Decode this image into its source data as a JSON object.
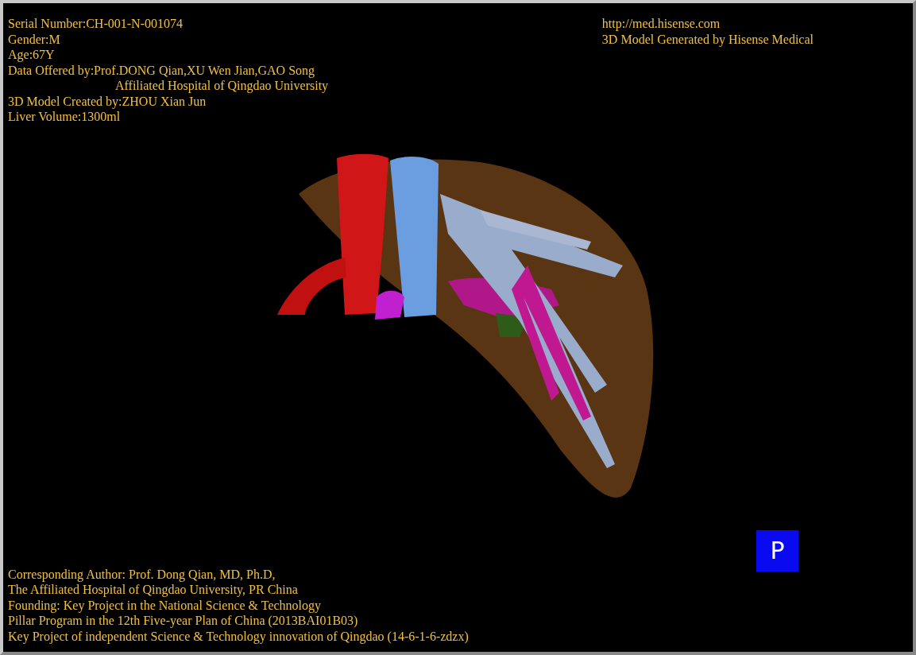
{
  "info_top_left": [
    "Serial Number:CH-001-N-001074",
    "Gender:M",
    "Age:67Y",
    "Data Offered by:Prof.DONG Qian,XU Wen Jian,GAO Song",
    "Affiliated Hospital of Qingdao University",
    "3D Model Created by:ZHOU Xian Jun",
    "Liver Volume:1300ml"
  ],
  "info_top_right": [
    "http://med.hisense.com",
    "3D Model Generated by Hisense Medical"
  ],
  "info_bottom": [
    "Corresponding Author: Prof. Dong Qian, MD, Ph.D,",
    "The Affiliated Hospital of Qingdao University, PR China",
    "Founding: Key Project in the National Science & Technology",
    "Pillar Program in the 12th Five-year Plan of China (2013BAI01B03)",
    "Key Project of independent Science & Technology innovation of Qingdao (14-6-1-6-zdzx)"
  ],
  "projection_button": "P"
}
